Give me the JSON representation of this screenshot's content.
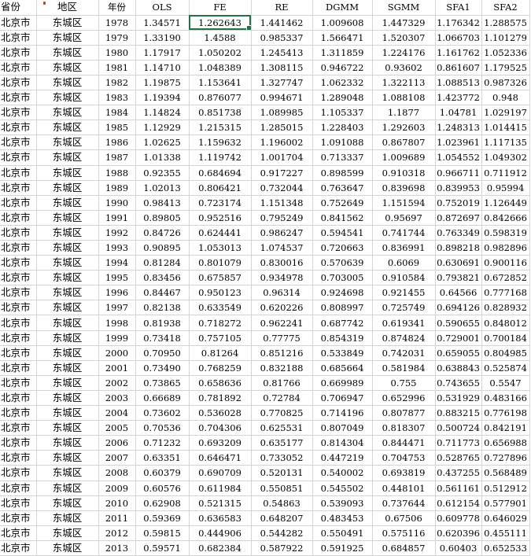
{
  "sheet": {
    "headers": [
      "省份",
      "地区",
      "年份",
      "OLS",
      "FE",
      "RE",
      "DGMM",
      "SGMM",
      "SFA1",
      "SFA2"
    ],
    "selected_cell": {
      "row": 0,
      "col": 4
    },
    "rows": [
      [
        "北京市",
        "东城区",
        "1978",
        "1.34571",
        "1.262643",
        "1.441462",
        "1.009608",
        "1.447329",
        "1.176342",
        "1.288575"
      ],
      [
        "北京市",
        "东城区",
        "1979",
        "1.33190",
        "1.4588",
        "0.985337",
        "1.566471",
        "1.520307",
        "1.066703",
        "1.101279"
      ],
      [
        "北京市",
        "东城区",
        "1980",
        "1.17917",
        "1.050202",
        "1.245413",
        "1.311859",
        "1.224176",
        "1.161762",
        "1.052336"
      ],
      [
        "北京市",
        "东城区",
        "1981",
        "1.14710",
        "1.048389",
        "1.308115",
        "0.946722",
        "0.93602",
        "0.861607",
        "1.179525"
      ],
      [
        "北京市",
        "东城区",
        "1982",
        "1.19875",
        "1.153641",
        "1.327747",
        "1.062332",
        "1.322113",
        "1.088513",
        "0.987326"
      ],
      [
        "北京市",
        "东城区",
        "1983",
        "1.19394",
        "0.876077",
        "0.994671",
        "1.289048",
        "1.088108",
        "1.423772",
        "0.948"
      ],
      [
        "北京市",
        "东城区",
        "1984",
        "1.14824",
        "0.851738",
        "1.089985",
        "1.105337",
        "1.1877",
        "1.04781",
        "1.029197"
      ],
      [
        "北京市",
        "东城区",
        "1985",
        "1.12929",
        "1.215315",
        "1.285015",
        "1.228403",
        "1.292603",
        "1.248313",
        "1.014415"
      ],
      [
        "北京市",
        "东城区",
        "1986",
        "1.02625",
        "1.159632",
        "1.196002",
        "1.091088",
        "0.867807",
        "1.023961",
        "1.117135"
      ],
      [
        "北京市",
        "东城区",
        "1987",
        "1.01338",
        "1.119742",
        "1.001704",
        "0.713337",
        "1.009689",
        "1.054552",
        "1.049302"
      ],
      [
        "北京市",
        "东城区",
        "1988",
        "0.92355",
        "0.684694",
        "0.917227",
        "0.898599",
        "0.910318",
        "0.966711",
        "0.711912"
      ],
      [
        "北京市",
        "东城区",
        "1989",
        "1.02013",
        "0.806421",
        "0.732044",
        "0.763647",
        "0.839698",
        "0.839953",
        "0.95994"
      ],
      [
        "北京市",
        "东城区",
        "1990",
        "0.98413",
        "0.723174",
        "1.151348",
        "0.752649",
        "1.151594",
        "0.752019",
        "1.126449"
      ],
      [
        "北京市",
        "东城区",
        "1991",
        "0.89805",
        "0.952516",
        "0.795249",
        "0.841562",
        "0.95697",
        "0.872697",
        "0.842666"
      ],
      [
        "北京市",
        "东城区",
        "1992",
        "0.84726",
        "0.624441",
        "0.986247",
        "0.594541",
        "0.741744",
        "0.763349",
        "0.598319"
      ],
      [
        "北京市",
        "东城区",
        "1993",
        "0.90895",
        "1.053013",
        "1.074537",
        "0.720663",
        "0.836991",
        "0.898218",
        "0.982896"
      ],
      [
        "北京市",
        "东城区",
        "1994",
        "0.81284",
        "0.801079",
        "0.830016",
        "0.570639",
        "0.6069",
        "0.630691",
        "0.900116"
      ],
      [
        "北京市",
        "东城区",
        "1995",
        "0.83456",
        "0.675857",
        "0.934978",
        "0.703005",
        "0.910584",
        "0.793821",
        "0.672852"
      ],
      [
        "北京市",
        "东城区",
        "1996",
        "0.84467",
        "0.950123",
        "0.96314",
        "0.924698",
        "0.921455",
        "0.64566",
        "0.777168"
      ],
      [
        "北京市",
        "东城区",
        "1997",
        "0.82138",
        "0.633549",
        "0.620226",
        "0.808997",
        "0.725749",
        "0.694126",
        "0.828932"
      ],
      [
        "北京市",
        "东城区",
        "1998",
        "0.81938",
        "0.718272",
        "0.962241",
        "0.687742",
        "0.619341",
        "0.590655",
        "0.848012"
      ],
      [
        "北京市",
        "东城区",
        "1999",
        "0.73418",
        "0.757105",
        "0.77775",
        "0.854319",
        "0.874824",
        "0.729001",
        "0.700184"
      ],
      [
        "北京市",
        "东城区",
        "2000",
        "0.70950",
        "0.81264",
        "0.851216",
        "0.533849",
        "0.742031",
        "0.659055",
        "0.804985"
      ],
      [
        "北京市",
        "东城区",
        "2001",
        "0.73490",
        "0.768259",
        "0.832188",
        "0.685664",
        "0.581984",
        "0.638843",
        "0.525874"
      ],
      [
        "北京市",
        "东城区",
        "2002",
        "0.73865",
        "0.658636",
        "0.81766",
        "0.669989",
        "0.755",
        "0.743655",
        "0.5547"
      ],
      [
        "北京市",
        "东城区",
        "2003",
        "0.66689",
        "0.781892",
        "0.72784",
        "0.706947",
        "0.652996",
        "0.531929",
        "0.483166"
      ],
      [
        "北京市",
        "东城区",
        "2004",
        "0.73602",
        "0.536028",
        "0.770825",
        "0.714196",
        "0.807877",
        "0.883215",
        "0.776198"
      ],
      [
        "北京市",
        "东城区",
        "2005",
        "0.70536",
        "0.704306",
        "0.625531",
        "0.807049",
        "0.818307",
        "0.500724",
        "0.842191"
      ],
      [
        "北京市",
        "东城区",
        "2006",
        "0.71232",
        "0.693209",
        "0.635177",
        "0.814304",
        "0.844471",
        "0.711773",
        "0.656988"
      ],
      [
        "北京市",
        "东城区",
        "2007",
        "0.63351",
        "0.646471",
        "0.733052",
        "0.447219",
        "0.704753",
        "0.528765",
        "0.727896"
      ],
      [
        "北京市",
        "东城区",
        "2008",
        "0.60379",
        "0.690709",
        "0.520131",
        "0.540002",
        "0.693819",
        "0.437255",
        "0.568489"
      ],
      [
        "北京市",
        "东城区",
        "2009",
        "0.60576",
        "0.611984",
        "0.550851",
        "0.545502",
        "0.448101",
        "0.561161",
        "0.512912"
      ],
      [
        "北京市",
        "东城区",
        "2010",
        "0.62908",
        "0.521315",
        "0.54863",
        "0.539093",
        "0.737644",
        "0.612154",
        "0.577901"
      ],
      [
        "北京市",
        "东城区",
        "2011",
        "0.59369",
        "0.636583",
        "0.648207",
        "0.483453",
        "0.67506",
        "0.609778",
        "0.646029"
      ],
      [
        "北京市",
        "东城区",
        "2012",
        "0.59815",
        "0.444906",
        "0.544282",
        "0.550491",
        "0.575116",
        "0.620396",
        "0.455111"
      ],
      [
        "北京市",
        "东城区",
        "2013",
        "0.59571",
        "0.682384",
        "0.587922",
        "0.591925",
        "0.684857",
        "0.60403",
        "0.652533"
      ]
    ]
  }
}
